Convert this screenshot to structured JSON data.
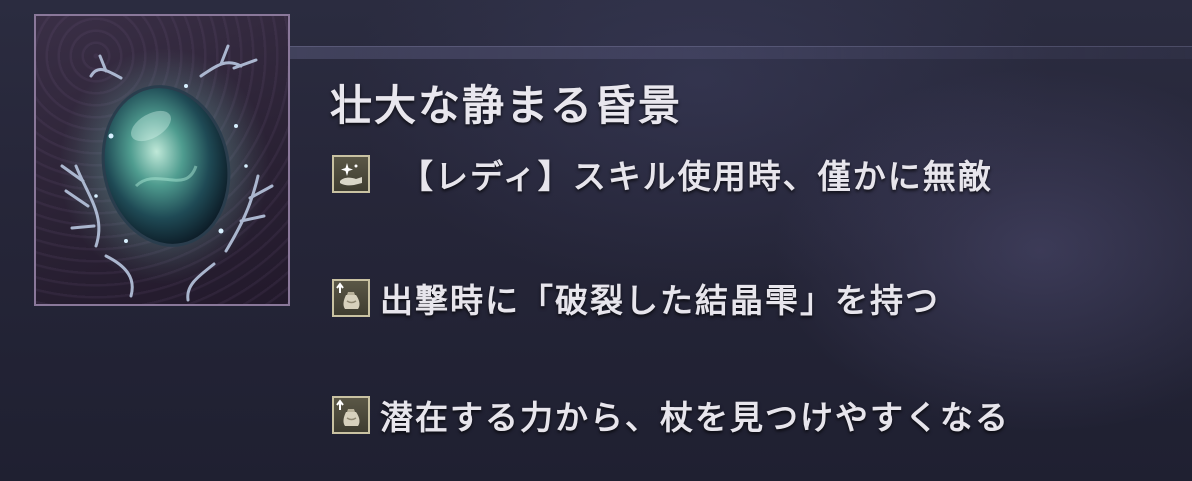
{
  "relic": {
    "icon": "crystal-egg-relic-icon",
    "name": "壮大な静まる昏景"
  },
  "effects": [
    {
      "icon": "hand-sparkle-icon",
      "text": "【レディ】スキル使用時、僅かに無敵"
    },
    {
      "icon": "item-pouch-icon",
      "text": "出撃時に「破裂した結晶雫」を持つ"
    },
    {
      "icon": "item-pouch-icon",
      "text": "潜在する力から、杖を見つけやすくなる"
    }
  ],
  "colors": {
    "frame_border": "#8a789a",
    "icon_border": "#c9c2a2",
    "text": "#e7e5ec"
  }
}
